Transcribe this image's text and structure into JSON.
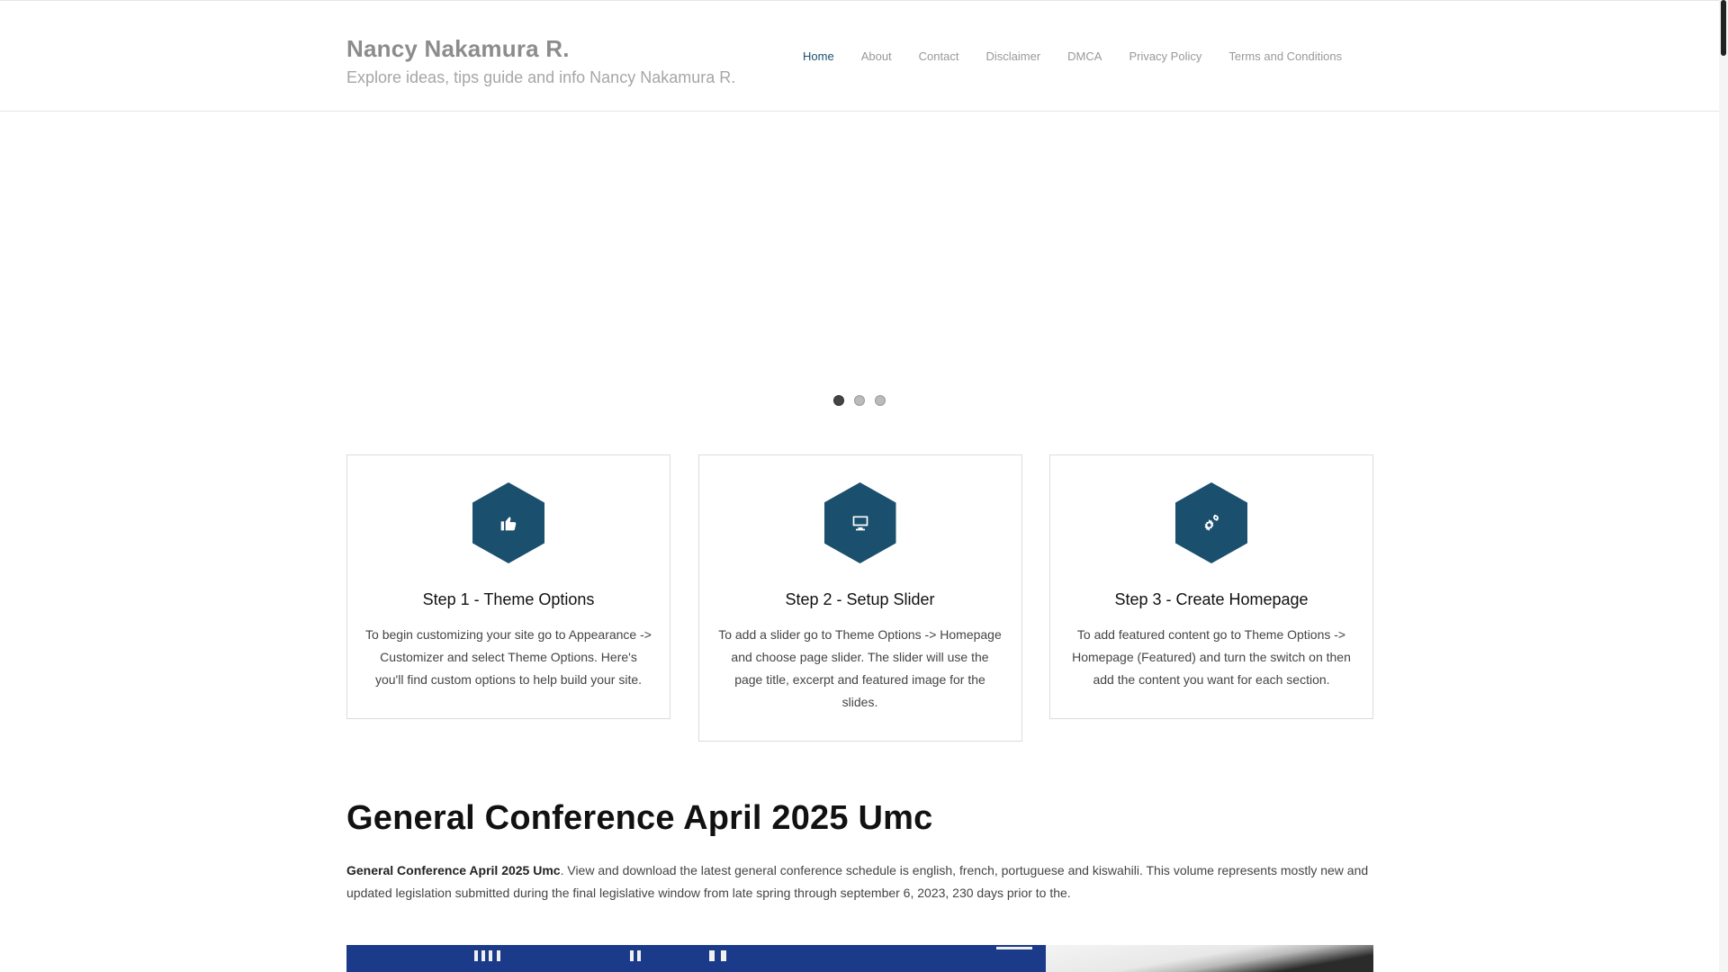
{
  "site": {
    "title": "Nancy Nakamura R.",
    "description": "Explore ideas, tips guide and info Nancy Nakamura R."
  },
  "nav": {
    "items": [
      {
        "label": "Home",
        "active": true
      },
      {
        "label": "About",
        "active": false
      },
      {
        "label": "Contact",
        "active": false
      },
      {
        "label": "Disclaimer",
        "active": false
      },
      {
        "label": "DMCA",
        "active": false
      },
      {
        "label": "Privacy Policy",
        "active": false
      },
      {
        "label": "Terms and Conditions",
        "active": false
      }
    ]
  },
  "slider": {
    "slide_count": 3,
    "active_index": 0
  },
  "features": [
    {
      "icon": "thumbs-up-icon",
      "title": "Step 1 - Theme Options",
      "text": "To begin customizing your site go to Appearance -> Customizer and select Theme Options. Here's you'll find custom options to help build your site."
    },
    {
      "icon": "desktop-icon",
      "title": "Step 2 - Setup Slider",
      "text": "To add a slider go to Theme Options -> Homepage and choose page slider. The slider will use the page title, excerpt and featured image for the slides."
    },
    {
      "icon": "gears-icon",
      "title": "Step 3 - Create Homepage",
      "text": "To add featured content go to Theme Options -> Homepage (Featured) and turn the switch on then add the content you want for each section."
    }
  ],
  "article": {
    "heading": "General Conference April 2025 Umc",
    "lead_bold": "General Conference April 2025 Umc",
    "body": ". View and download the latest general conference schedule is english, french, portuguese and kiswahili. This volume represents mostly new and updated legislation submitted during the final legislative window from late spring through september 6, 2023, 230 days prior to the."
  },
  "colors": {
    "accent": "#1a4f6e",
    "nav_text": "#999999",
    "title_text": "#8c8c8c"
  }
}
